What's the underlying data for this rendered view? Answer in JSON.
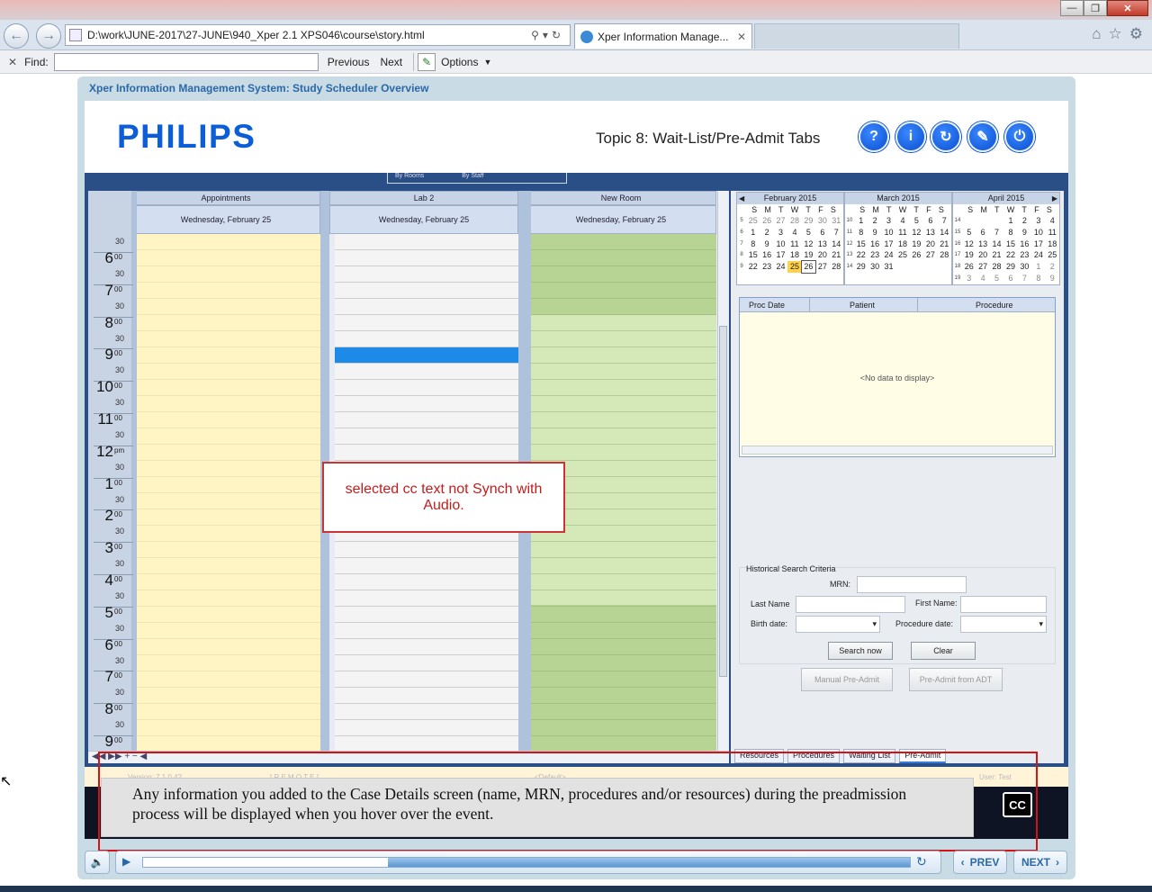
{
  "browser": {
    "url": "D:\\work\\JUNE-2017\\27-JUNE\\940_Xper 2.1 XPS046\\course\\story.html",
    "active_tab": "Xper Information Manage...",
    "find_label": "Find:",
    "find_value": "",
    "previous_label": "Previous",
    "next_label": "Next",
    "options_label": "Options"
  },
  "course": {
    "title": "Xper Information Management System: Study Scheduler Overview",
    "logo": "PHILIPS",
    "topic": "Topic 8: Wait-List/Pre-Admit Tabs",
    "help_icon_glyph": "?",
    "info_icon_glyph": "i"
  },
  "scheduler": {
    "view_options": [
      "By Rooms",
      "By Staff"
    ],
    "columns": [
      {
        "name": "Appointments",
        "date": "Wednesday, February 25"
      },
      {
        "name": "Lab 2",
        "date": "Wednesday, February 25"
      },
      {
        "name": "New Room",
        "date": "Wednesday, February 25"
      }
    ],
    "hours": [
      {
        "h": "6",
        "m": "00"
      },
      {
        "h": "7",
        "m": "00"
      },
      {
        "h": "8",
        "m": "00"
      },
      {
        "h": "9",
        "m": "00"
      },
      {
        "h": "10",
        "m": "00"
      },
      {
        "h": "11",
        "m": "00"
      },
      {
        "h": "12",
        "m": "pm"
      },
      {
        "h": "1",
        "m": "00"
      },
      {
        "h": "2",
        "m": "00"
      },
      {
        "h": "3",
        "m": "00"
      },
      {
        "h": "4",
        "m": "00"
      },
      {
        "h": "5",
        "m": "00"
      },
      {
        "h": "6",
        "m": "00"
      },
      {
        "h": "7",
        "m": "00"
      },
      {
        "h": "8",
        "m": "00"
      },
      {
        "h": "9",
        "m": "00"
      }
    ],
    "half_label": "30"
  },
  "calendars": [
    {
      "month": "February 2015",
      "weeks": [
        "5",
        "6",
        "7",
        "8",
        "9"
      ],
      "days": [
        [
          "25",
          "26",
          "27",
          "28",
          "29",
          "30",
          "31"
        ],
        [
          "1",
          "2",
          "3",
          "4",
          "5",
          "6",
          "7"
        ],
        [
          "8",
          "9",
          "10",
          "11",
          "12",
          "13",
          "14"
        ],
        [
          "15",
          "16",
          "17",
          "18",
          "19",
          "20",
          "21"
        ],
        [
          "22",
          "23",
          "24",
          "25",
          "26",
          "27",
          "28"
        ]
      ]
    },
    {
      "month": "March 2015",
      "weeks": [
        "10",
        "11",
        "12",
        "13",
        "14"
      ],
      "days": [
        [
          "1",
          "2",
          "3",
          "4",
          "5",
          "6",
          "7"
        ],
        [
          "8",
          "9",
          "10",
          "11",
          "12",
          "13",
          "14"
        ],
        [
          "15",
          "16",
          "17",
          "18",
          "19",
          "20",
          "21"
        ],
        [
          "22",
          "23",
          "24",
          "25",
          "26",
          "27",
          "28"
        ],
        [
          "29",
          "30",
          "31",
          "",
          "",
          "",
          ""
        ]
      ]
    },
    {
      "month": "April 2015",
      "weeks": [
        "14",
        "15",
        "16",
        "17",
        "18",
        "19"
      ],
      "days": [
        [
          "",
          "",
          "",
          "1",
          "2",
          "3",
          "4"
        ],
        [
          "5",
          "6",
          "7",
          "8",
          "9",
          "10",
          "11"
        ],
        [
          "12",
          "13",
          "14",
          "15",
          "16",
          "17",
          "18"
        ],
        [
          "19",
          "20",
          "21",
          "22",
          "23",
          "24",
          "25"
        ],
        [
          "26",
          "27",
          "28",
          "29",
          "30",
          "1",
          "2"
        ],
        [
          "3",
          "4",
          "5",
          "6",
          "7",
          "8",
          "9"
        ]
      ]
    }
  ],
  "weekday_letters": [
    "S",
    "M",
    "T",
    "W",
    "T",
    "F",
    "S"
  ],
  "grid": {
    "headers": [
      "Proc Date",
      "Patient",
      "Procedure"
    ],
    "empty_text": "<No data to display>"
  },
  "search": {
    "section_title": "Historical Search Criteria",
    "mrn_label": "MRN:",
    "last_name_label": "Last Name",
    "first_name_label": "First Name:",
    "birth_date_label": "Birth date:",
    "procedure_date_label": "Procedure date:",
    "search_button": "Search now",
    "clear_button": "Clear",
    "manual_preadmit_button": "Manual Pre-Admit",
    "preadmit_adt_button": "Pre-Admit from ADT"
  },
  "right_tabs": [
    "Resources",
    "Procedures",
    "Waiting List",
    "Pre-Admit"
  ],
  "annotation": "selected cc text not Synch with Audio.",
  "captions": {
    "text": "Any information you added to the Case Details screen (name, MRN, procedures and/or resources) during the preadmission process will be displayed when you hover over the event.",
    "cc_label": "CC"
  },
  "player": {
    "prev_label": "PREV",
    "next_label": "NEXT",
    "progress": 0.32
  },
  "status": {
    "version": "Version: 7.1.0.42",
    "mode": "[ R E M O T E ]",
    "default": "<Default>",
    "user": "User: Test"
  }
}
